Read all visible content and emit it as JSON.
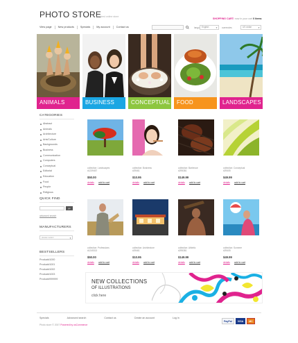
{
  "header": {
    "logo": "PHOTO STORE",
    "tagline": "the best online store",
    "cart_label": "SHOPPING CART:",
    "cart_text": "now in your cart",
    "cart_count": "0 items"
  },
  "nav": {
    "items": [
      "View page",
      "New products",
      "Specials",
      "My account",
      "Contact us"
    ]
  },
  "search": {
    "placeholder": ""
  },
  "language": {
    "label": "language",
    "value": "English"
  },
  "currency": {
    "label": "currencies",
    "value": "US dollar"
  },
  "banner": {
    "tiles": [
      {
        "label": "ANIMALS",
        "color": "#e0238e"
      },
      {
        "label": "BUSINESS",
        "color": "#1aa6e3"
      },
      {
        "label": "CONCEPTUAL",
        "color": "#8dc63f"
      },
      {
        "label": "FOOD",
        "color": "#f7941d"
      },
      {
        "label": "LANDSCAPES",
        "color": "#e0238e"
      }
    ]
  },
  "sidebar": {
    "categories_title": "CATEGORIES",
    "categories": [
      "Abstract",
      "Animals",
      "Architecture",
      "Arts/Culture",
      "Backgrounds",
      "Business",
      "Communication",
      "Computers",
      "Conceptual",
      "Editorial",
      "Education",
      "Food",
      "People",
      "Religious"
    ],
    "quickfind_title": "QUICK FIND",
    "quickfind_button": "go",
    "advanced_search": "advanced search",
    "manufacturers_title": "MANUFACTURERS",
    "manufacturers_select": "please select",
    "bestsellers_title": "BESTSELLERS",
    "bestsellers": [
      "Product#1000",
      "Product#1001",
      "Product#1002",
      "Product#1003",
      "Product#999999"
    ]
  },
  "products": [
    {
      "desc1": "collection: Landscapes",
      "desc2": "#1239457",
      "price": "$50.00",
      "details": "details",
      "add": "add to cart"
    },
    {
      "desc1": "collection: Business",
      "desc2": "#29461",
      "price": "$10.95",
      "details": "details",
      "add": "add to cart"
    },
    {
      "desc1": "collection: Barbecue",
      "desc2": "#295381",
      "price": "$149.99",
      "details": "details",
      "add": "add to cart"
    },
    {
      "desc1": "collection: Conceptual",
      "desc2": "#29405",
      "price": "$49.99",
      "details": "details",
      "add": "add to cart"
    },
    {
      "desc1": "collection: Professions",
      "desc2": "#1245313",
      "price": "$50.00",
      "details": "details",
      "add": "add to cart"
    },
    {
      "desc1": "collection: Architecture",
      "desc2": "#29461",
      "price": "$10.95",
      "details": "details",
      "add": "add to cart"
    },
    {
      "desc1": "collection: Athletic",
      "desc2": "#295381",
      "price": "$149.99",
      "details": "details",
      "add": "add to cart"
    },
    {
      "desc1": "collection: Summer",
      "desc2": "#29405",
      "price": "$49.99",
      "details": "details",
      "add": "add to cart"
    }
  ],
  "promo": {
    "title": "NEW COLLECTIONS",
    "subtitle": "OF ILLUSTRATIONS",
    "link": "click here"
  },
  "footer": {
    "links": [
      "Specials",
      "Advanced search",
      "Contact us",
      "Create an account",
      "Log in"
    ],
    "copyright": "Photo store © 2007",
    "powered": "Powered by osCommerce",
    "pay1": "PayPal",
    "pay2": "VISA",
    "pay3": "MC"
  }
}
